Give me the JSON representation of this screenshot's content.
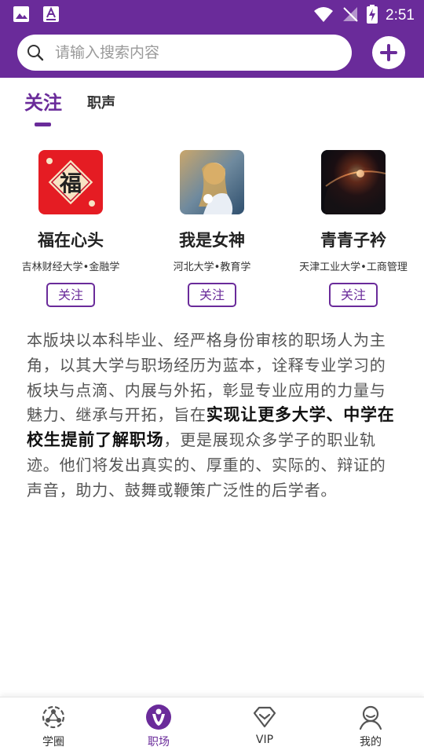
{
  "status_bar": {
    "time": "2:51"
  },
  "search": {
    "placeholder": "请输入搜索内容",
    "value": ""
  },
  "tabs": [
    {
      "label": "关注",
      "active": true
    },
    {
      "label": "职声",
      "active": false
    }
  ],
  "users": [
    {
      "name": "福在心头",
      "school": "吉林财经大学•金融学",
      "follow_label": "关注",
      "avatar_glyph": "福"
    },
    {
      "name": "我是女神",
      "school": "河北大学•教育学",
      "follow_label": "关注"
    },
    {
      "name": "青青子衿",
      "school": "天津工业大学•工商管理",
      "follow_label": "关注"
    }
  ],
  "description": {
    "part1": "本版块以本科毕业、经严格身份审核的职场人为主角，以其大学与职场经历为蓝本，诠释专业学习的板块与点滴、内展与外拓，彰显专业应用的力量与魅力、继承与开拓，旨在",
    "highlight": "实现让更多大学、中学在校生提前了解职场",
    "part2": "，更是展现众多学子的职业轨迹。他们将发出真实的、厚重的、实际的、辩证的声音，助力、鼓舞或鞭策广泛性的后学者。"
  },
  "bottom_nav": [
    {
      "label": "学圈",
      "icon": "circle-network-icon",
      "active": false
    },
    {
      "label": "职场",
      "icon": "workplace-person-icon",
      "active": true
    },
    {
      "label": "VIP",
      "icon": "diamond-icon",
      "active": false
    },
    {
      "label": "我的",
      "icon": "user-profile-icon",
      "active": false
    }
  ],
  "colors": {
    "brand": "#6a2b9a",
    "text": "#333333",
    "muted": "#9a9a9a"
  }
}
